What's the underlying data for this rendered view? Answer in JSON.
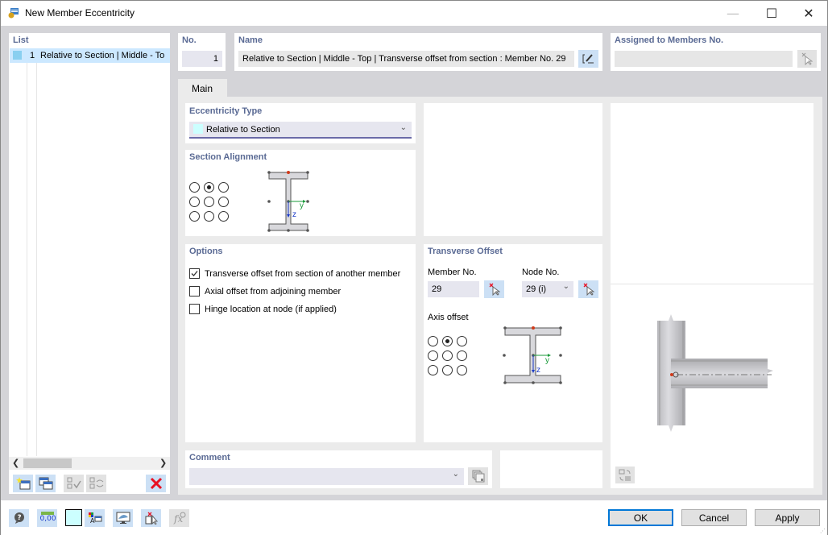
{
  "window": {
    "title": "New Member Eccentricity",
    "minimize_glyph": "—",
    "maximize_glyph": "☐",
    "close_glyph": "✕"
  },
  "list": {
    "label": "List",
    "items": [
      {
        "number": "1",
        "text": "Relative to Section | Middle - To",
        "color": "#89cff0"
      }
    ]
  },
  "number": {
    "label": "No.",
    "value": "1"
  },
  "name": {
    "label": "Name",
    "value": "Relative to Section | Middle - Top | Transverse offset from section : Member No. 29"
  },
  "assigned": {
    "label": "Assigned to Members No.",
    "value": ""
  },
  "tabs": [
    {
      "label": "Main"
    }
  ],
  "eccentricity_type": {
    "label": "Eccentricity Type",
    "value": "Relative to Section",
    "swatch_color": "#ccffff"
  },
  "section_alignment": {
    "label": "Section Alignment",
    "selected": "top-center",
    "axes": {
      "y": "y",
      "z": "z"
    }
  },
  "options": {
    "label": "Options",
    "items": [
      {
        "label": "Transverse offset from section of another member",
        "checked": true
      },
      {
        "label": "Axial offset from adjoining member",
        "checked": false
      },
      {
        "label": "Hinge location at node (if applied)",
        "checked": false
      }
    ]
  },
  "transverse_offset": {
    "label": "Transverse Offset",
    "member_label": "Member No.",
    "member_value": "29",
    "node_label": "Node No.",
    "node_value": "29 (i)",
    "axis_offset_label": "Axis offset",
    "axis_selected": "top-center",
    "axes": {
      "y": "y",
      "z": "z"
    }
  },
  "comment": {
    "label": "Comment",
    "value": ""
  },
  "buttons": {
    "ok": "OK",
    "cancel": "Cancel",
    "apply": "Apply"
  },
  "bottom_toolbar": {
    "units_text": "0,00",
    "color_swatch": "#ccffff"
  },
  "colors": {
    "accent": "#0078d7",
    "label_blue": "#5a6a94",
    "icon_bg": "#cce0f5",
    "delete_red": "#e81123"
  }
}
